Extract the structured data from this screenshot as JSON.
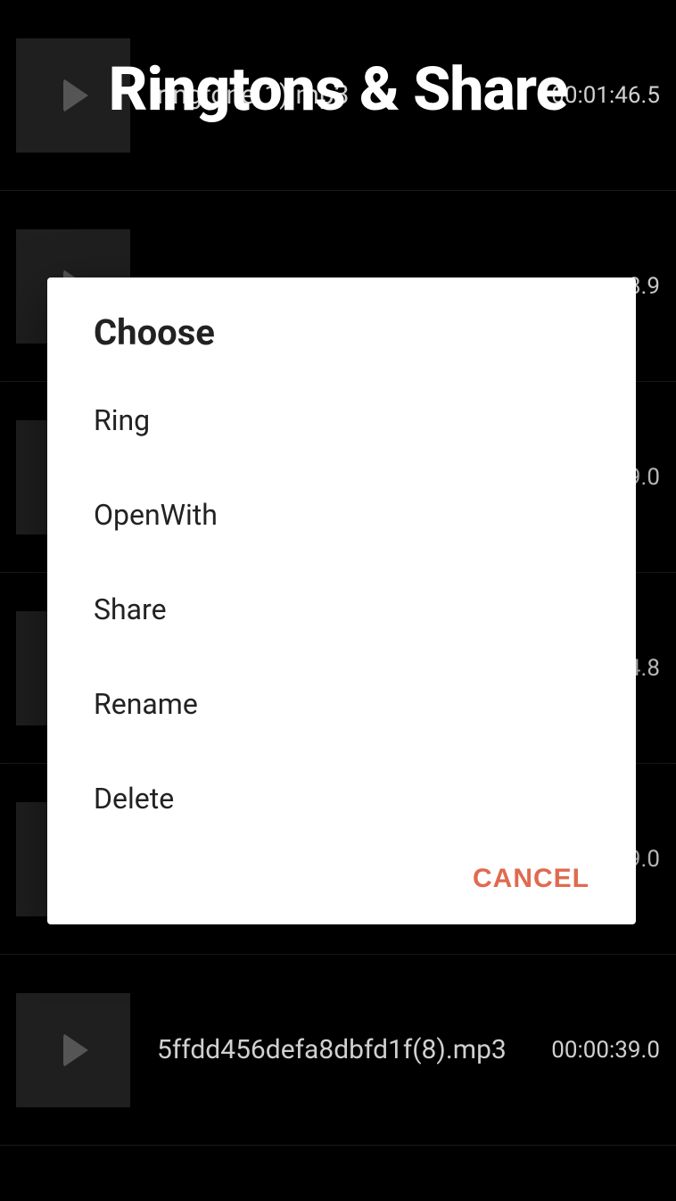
{
  "header": {
    "title": "Ringtons & Share"
  },
  "list": {
    "items": [
      {
        "filename": "ringtone(1).mp3",
        "duration": "00:01:46.5"
      },
      {
        "filename": "",
        "duration": "8.9"
      },
      {
        "filename": "",
        "duration": "9.0"
      },
      {
        "filename": "",
        "duration": "4.8"
      },
      {
        "filename": "",
        "duration": "9.0"
      },
      {
        "filename": "5ffdd456defa8dbfd1f(8).mp3",
        "duration": "00:00:39.0"
      }
    ]
  },
  "dialog": {
    "title": "Choose",
    "options": [
      {
        "label": "Ring"
      },
      {
        "label": "OpenWith"
      },
      {
        "label": "Share"
      },
      {
        "label": "Rename"
      },
      {
        "label": "Delete"
      }
    ],
    "cancel_label": "CANCEL"
  }
}
